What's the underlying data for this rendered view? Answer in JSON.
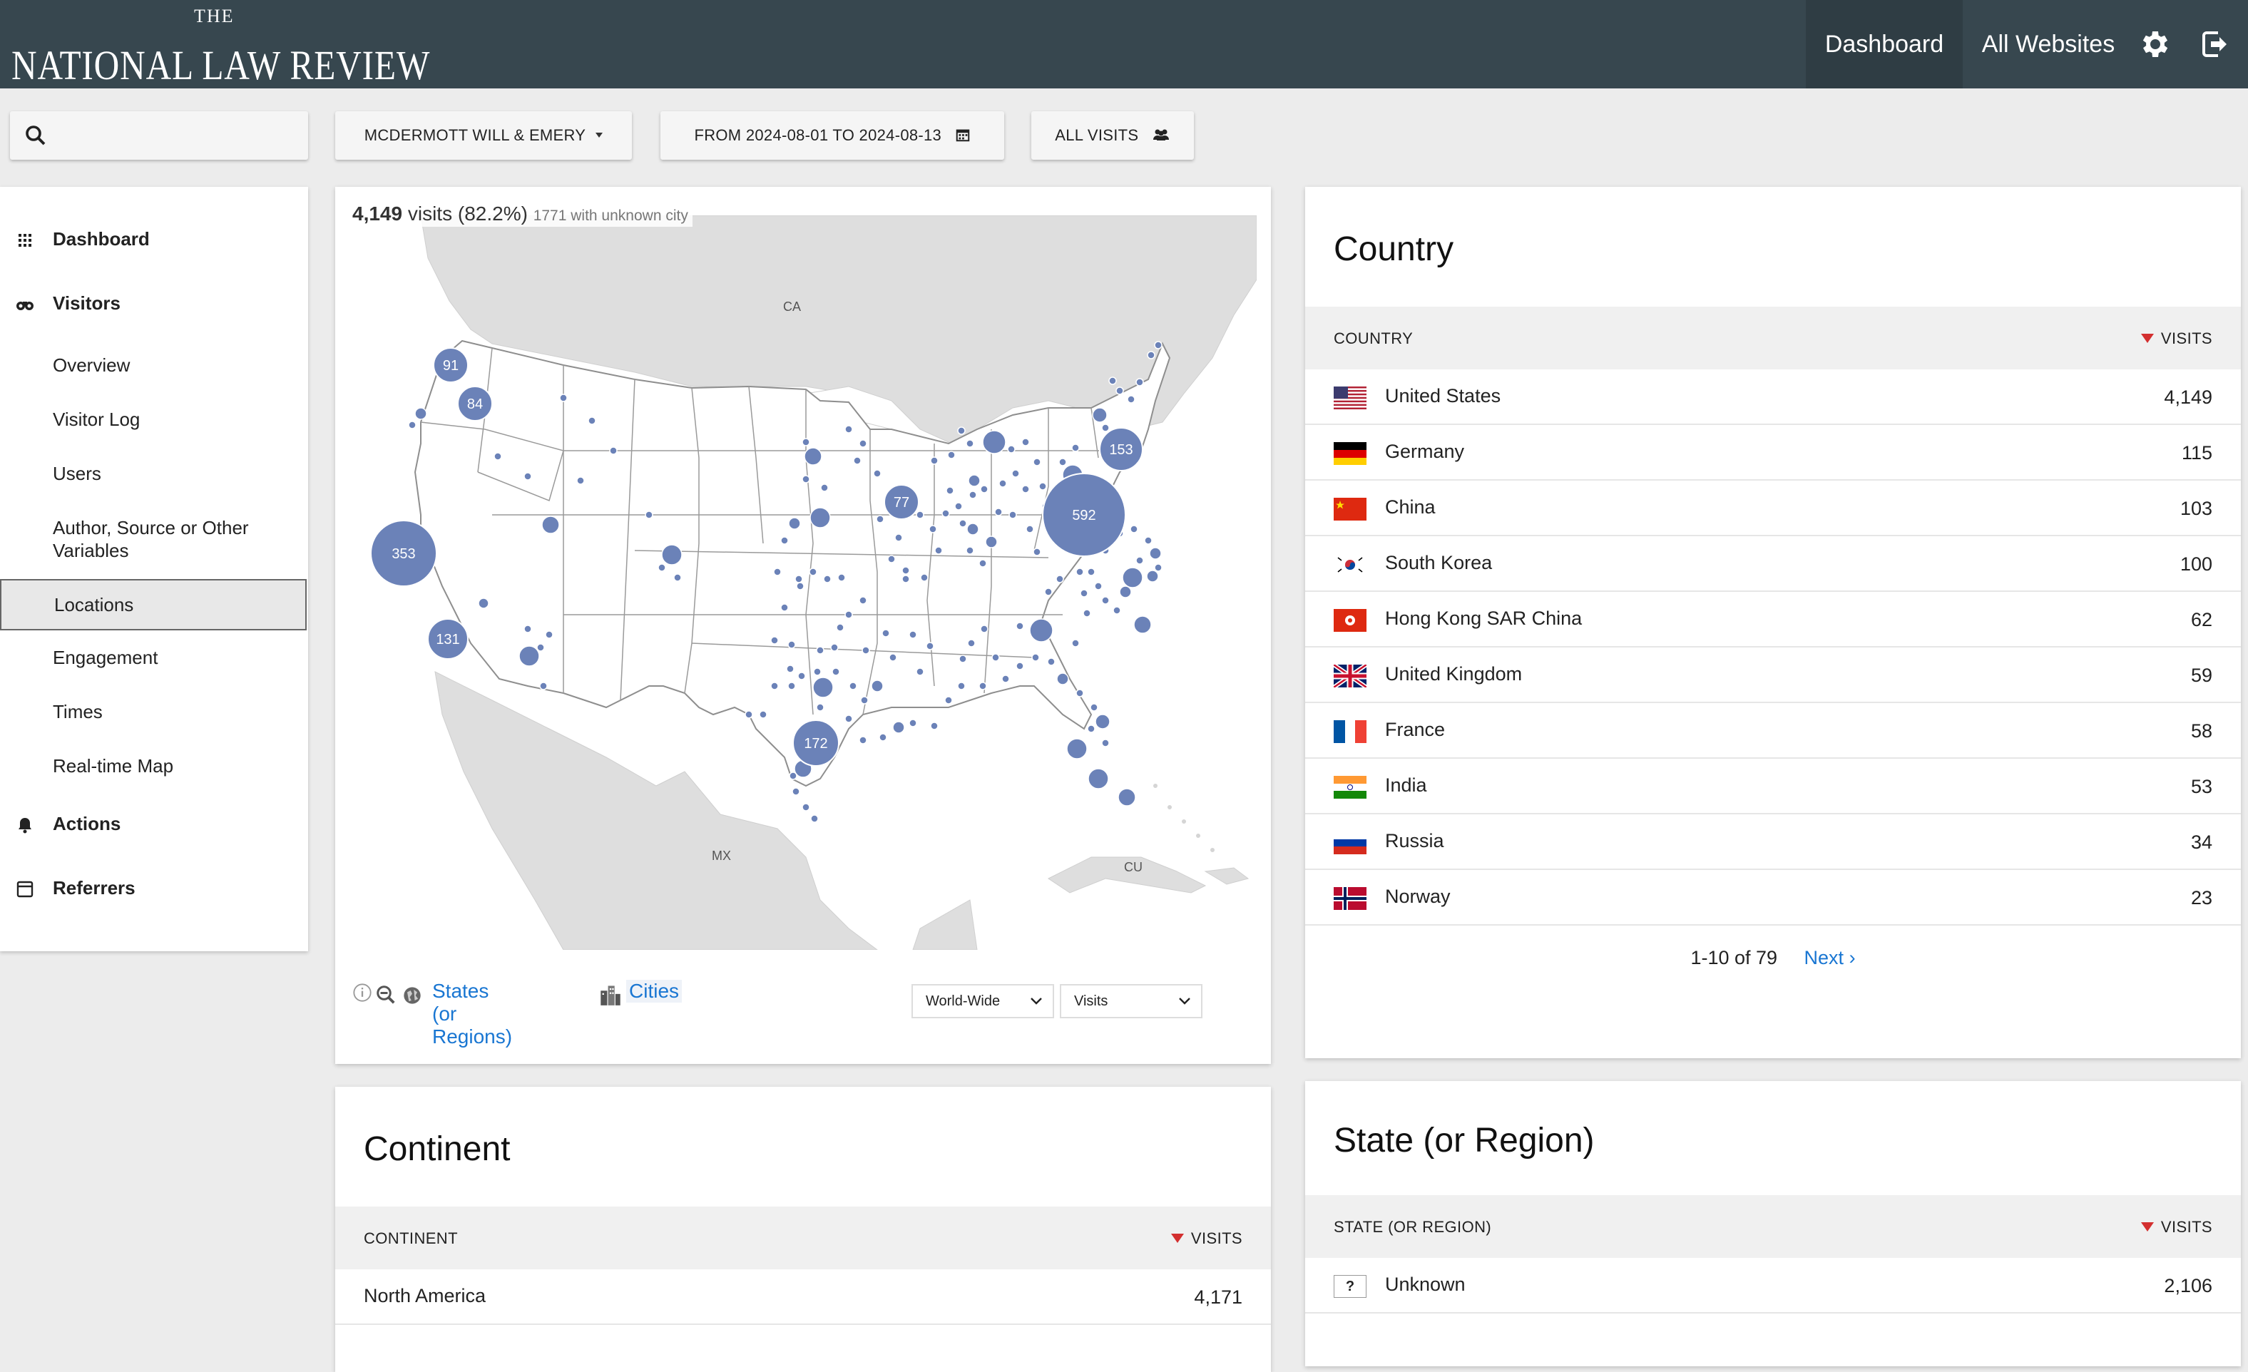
{
  "header": {
    "logo_the": "THE",
    "logo_name": "NATIONAL LAW REVIEW",
    "nav": {
      "dashboard": "Dashboard",
      "all_websites": "All Websites"
    }
  },
  "toolbar": {
    "site": "MCDERMOTT WILL & EMERY",
    "period": "FROM 2024-08-01 TO 2024-08-13",
    "segment": "ALL VISITS"
  },
  "sidebar": {
    "dashboard": "Dashboard",
    "visitors": "Visitors",
    "overview": "Overview",
    "visitor_log": "Visitor Log",
    "users": "Users",
    "custom_vars": "Author, Source or Other Variables",
    "locations": "Locations",
    "engagement": "Engagement",
    "times": "Times",
    "realtime": "Real-time Map",
    "actions": "Actions",
    "referrers": "Referrers"
  },
  "map": {
    "visits": "4,149",
    "visits_word": "visits",
    "pct": "(82.2%)",
    "unknown_city": "1771 with unknown city",
    "labels": {
      "ca": "CA",
      "mx": "MX",
      "cu": "CU"
    },
    "bubbles": [
      "91",
      "84",
      "353",
      "131",
      "77",
      "592",
      "153",
      "172"
    ],
    "states_link": "States (or Regions)",
    "cities_link": "Cities",
    "scope_select": "World-Wide",
    "metric_select": "Visits"
  },
  "country": {
    "title": "Country",
    "col_label": "COUNTRY",
    "col_value": "VISITS",
    "rows": [
      {
        "label": "United States",
        "value": "4,149",
        "flag": "us"
      },
      {
        "label": "Germany",
        "value": "115",
        "flag": "de"
      },
      {
        "label": "China",
        "value": "103",
        "flag": "cn"
      },
      {
        "label": "South Korea",
        "value": "100",
        "flag": "kr"
      },
      {
        "label": "Hong Kong SAR China",
        "value": "62",
        "flag": "hk"
      },
      {
        "label": "United Kingdom",
        "value": "59",
        "flag": "gb"
      },
      {
        "label": "France",
        "value": "58",
        "flag": "fr"
      },
      {
        "label": "India",
        "value": "53",
        "flag": "in"
      },
      {
        "label": "Russia",
        "value": "34",
        "flag": "ru"
      },
      {
        "label": "Norway",
        "value": "23",
        "flag": "no"
      }
    ],
    "pager": "1-10 of 79",
    "next": "Next ›"
  },
  "continent": {
    "title": "Continent",
    "col_label": "CONTINENT",
    "col_value": "VISITS",
    "rows": [
      {
        "label": "North America",
        "value": "4,171"
      }
    ]
  },
  "state": {
    "title": "State (or Region)",
    "col_label": "STATE (OR REGION)",
    "col_value": "VISITS",
    "rows": [
      {
        "label": "Unknown",
        "value": "2,106",
        "icon": "?"
      }
    ]
  }
}
